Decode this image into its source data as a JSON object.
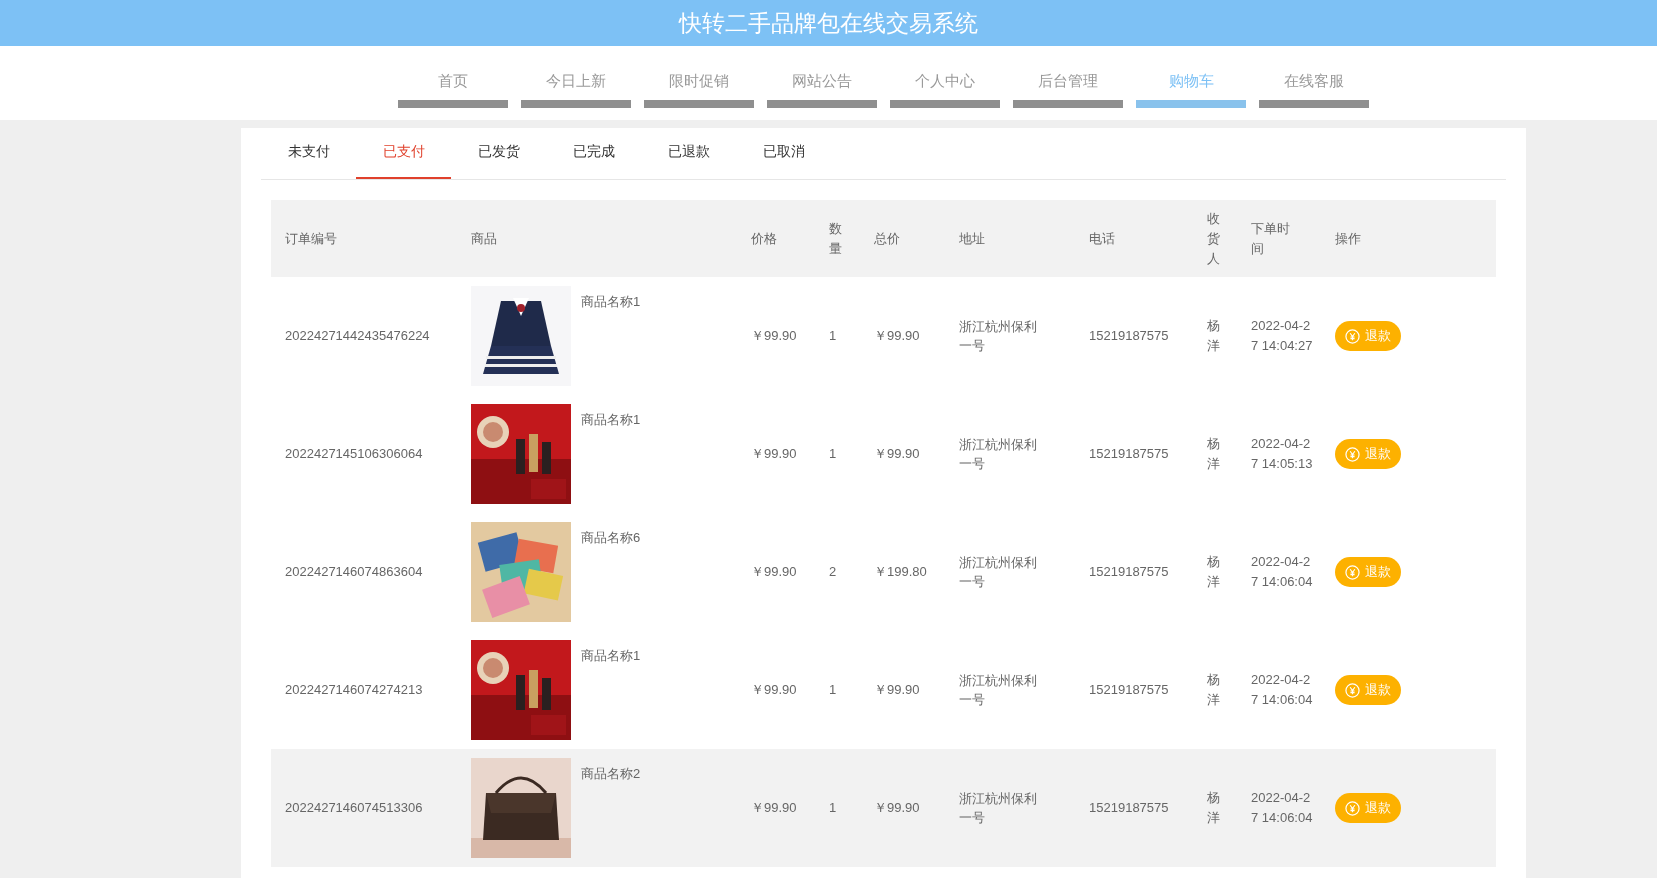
{
  "header": {
    "title": "快转二手品牌包在线交易系统"
  },
  "nav": [
    {
      "label": "首页",
      "selected": false
    },
    {
      "label": "今日上新",
      "selected": false
    },
    {
      "label": "限时促销",
      "selected": false
    },
    {
      "label": "网站公告",
      "selected": false
    },
    {
      "label": "个人中心",
      "selected": false
    },
    {
      "label": "后台管理",
      "selected": false
    },
    {
      "label": "购物车",
      "selected": true
    },
    {
      "label": "在线客服",
      "selected": false
    }
  ],
  "order_tabs": [
    {
      "label": "未支付",
      "selected": false
    },
    {
      "label": "已支付",
      "selected": true
    },
    {
      "label": "已发货",
      "selected": false
    },
    {
      "label": "已完成",
      "selected": false
    },
    {
      "label": "已退款",
      "selected": false
    },
    {
      "label": "已取消",
      "selected": false
    }
  ],
  "table": {
    "columns": [
      "订单编号",
      "商品",
      "价格",
      "数量",
      "总价",
      "地址",
      "电话",
      "收货人",
      "下单时间",
      "操作"
    ],
    "rows": [
      {
        "order_no": "20224271442435476224",
        "product": "商品名称1",
        "price": "￥99.90",
        "qty": "1",
        "total": "￥99.90",
        "address": "浙江杭州保利一号",
        "phone": "15219187575",
        "receiver": "杨洋",
        "time": "2022-04-27 14:04:27",
        "action": "退款",
        "highlighted": false
      },
      {
        "order_no": "2022427145106306064",
        "product": "商品名称1",
        "price": "￥99.90",
        "qty": "1",
        "total": "￥99.90",
        "address": "浙江杭州保利一号",
        "phone": "15219187575",
        "receiver": "杨洋",
        "time": "2022-04-27 14:05:13",
        "action": "退款",
        "highlighted": false
      },
      {
        "order_no": "2022427146074863604",
        "product": "商品名称6",
        "price": "￥99.90",
        "qty": "2",
        "total": "￥199.80",
        "address": "浙江杭州保利一号",
        "phone": "15219187575",
        "receiver": "杨洋",
        "time": "2022-04-27 14:06:04",
        "action": "退款",
        "highlighted": false
      },
      {
        "order_no": "2022427146074274213",
        "product": "商品名称1",
        "price": "￥99.90",
        "qty": "1",
        "total": "￥99.90",
        "address": "浙江杭州保利一号",
        "phone": "15219187575",
        "receiver": "杨洋",
        "time": "2022-04-27 14:06:04",
        "action": "退款",
        "highlighted": false
      },
      {
        "order_no": "2022427146074513306",
        "product": "商品名称2",
        "price": "￥99.90",
        "qty": "1",
        "total": "￥99.90",
        "address": "浙江杭州保利一号",
        "phone": "15219187575",
        "receiver": "杨洋",
        "time": "2022-04-27 14:06:04",
        "action": "退款",
        "highlighted": true
      }
    ]
  }
}
